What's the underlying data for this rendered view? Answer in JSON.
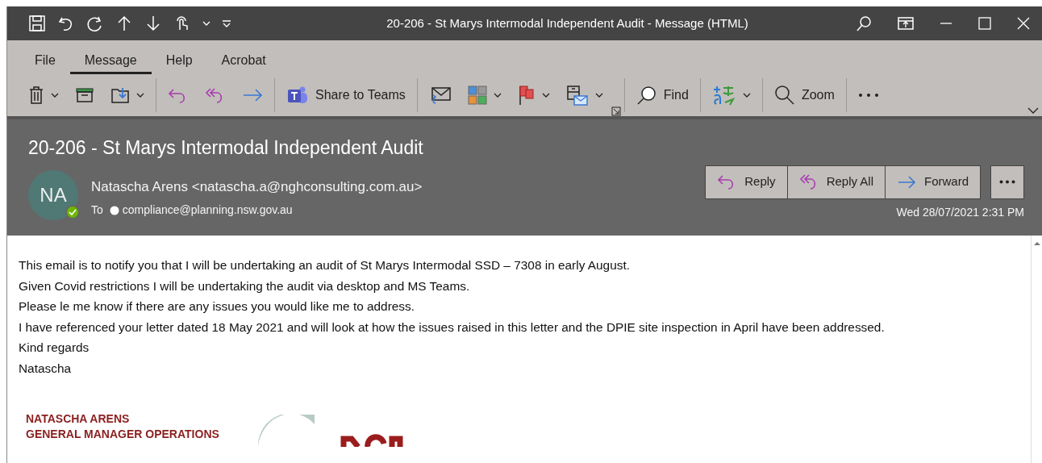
{
  "window": {
    "title": "20-206 - St Marys Intermodal Independent Audit  -  Message (HTML)"
  },
  "tabs": [
    {
      "label": "File",
      "selected": false
    },
    {
      "label": "Message",
      "selected": true
    },
    {
      "label": "Help",
      "selected": false
    },
    {
      "label": "Acrobat",
      "selected": false
    }
  ],
  "toolbar": {
    "share_button": "Share to Teams",
    "find_button": "Find",
    "zoom_button": "Zoom"
  },
  "message": {
    "subject": "20-206 - St Marys Intermodal Independent Audit",
    "avatar": "NA",
    "sender": "Natascha Arens <natascha.a@nghconsulting.com.au>",
    "to_label": "To",
    "recipient": "compliance@planning.nsw.gov.au",
    "actions": [
      "Reply",
      "Reply All",
      "Forward"
    ],
    "date": "Wed 28/07/2021 2:31 PM"
  },
  "body": {
    "paragraphs": [
      "This email is to notify you that I will be undertaking an audit of St Marys Intermodal SSD – 7308 in early August.",
      "Given Covid restrictions I will be undertaking the audit via desktop and MS Teams.",
      "Please le me know if there are any issues you would like me to address.",
      "I have referenced your letter dated 18 May 2021 and will look at how the issues raised in this letter and the DPIE site inspection in April have been addressed.",
      "Kind regards",
      "Natascha"
    ],
    "signature": [
      "NATASCHA ARENS",
      "GENERAL MANAGER OPERATIONS"
    ]
  }
}
